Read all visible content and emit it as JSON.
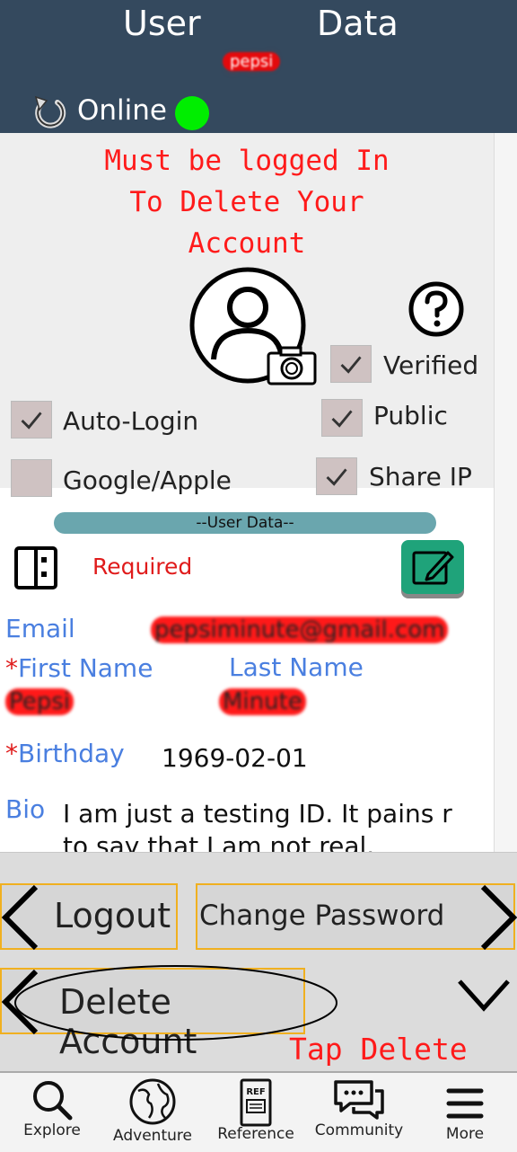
{
  "header": {
    "title_left": "User",
    "title_right": "Data",
    "username": "pepsi",
    "status_label": "Online",
    "status_color": "#00ee00",
    "background": "#34495e"
  },
  "warning": {
    "line1": "Must be logged In",
    "line2": "To Delete Your",
    "line3": "Account"
  },
  "options": {
    "verified": {
      "label": "Verified",
      "checked": true
    },
    "auto_login": {
      "label": "Auto-Login",
      "checked": true
    },
    "public": {
      "label": "Public",
      "checked": true
    },
    "google_apple": {
      "label": "Google/Apple",
      "checked": false
    },
    "share_ip": {
      "label": "Share IP",
      "checked": true
    }
  },
  "user_data": {
    "section_title": "--User Data--",
    "required_label": "Required",
    "email_label": "Email",
    "email_value": "pepsiminute@gmail.com",
    "first_name_label": "First Name",
    "first_name_value": "Pepsi",
    "last_name_label": "Last Name",
    "last_name_value": "Minute",
    "birthday_label": "Birthday",
    "birthday_value": "1969-02-01",
    "bio_label": "Bio",
    "bio_line1": "I am just a testing ID. It pains r",
    "bio_line2": "to say that I am not real.",
    "required_marker": "*"
  },
  "actions": {
    "logout": "Logout",
    "change_password": "Change Password",
    "delete_account": "Delete Account",
    "tap_delete": "Tap Delete"
  },
  "nav": [
    {
      "label": "Explore",
      "icon": "search-icon"
    },
    {
      "label": "Adventure",
      "icon": "globe-icon"
    },
    {
      "label": "Reference",
      "icon": "book-icon"
    },
    {
      "label": "Community",
      "icon": "chat-icon"
    },
    {
      "label": "More",
      "icon": "menu-icon"
    }
  ]
}
